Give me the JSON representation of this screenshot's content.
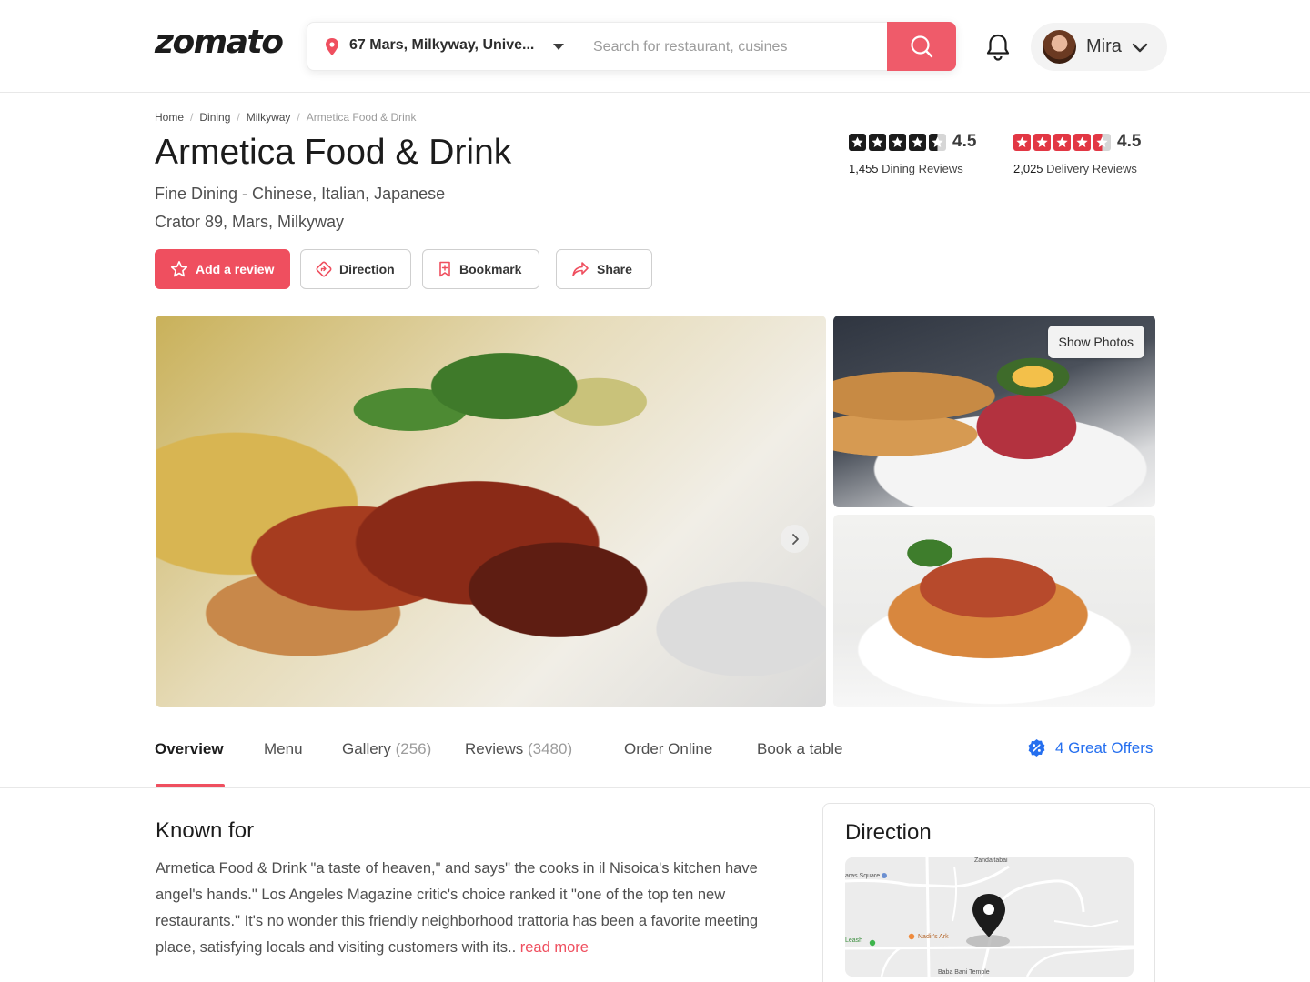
{
  "header": {
    "logo": "zomato",
    "location": "67 Mars, Milkyway, Unive...",
    "search_placeholder": "Search for restaurant, cusines",
    "user_name": "Mira"
  },
  "breadcrumb": [
    "Home",
    "Dining",
    "Milkyway",
    "Armetica Food & Drink"
  ],
  "restaurant": {
    "name": "Armetica Food & Drink",
    "cuisines": "Fine Dining - Chinese, Italian, Japanese",
    "address": "Crator 89, Mars, Milkyway"
  },
  "ratings": {
    "dining": {
      "value": "4.5",
      "count": "1,455",
      "label": "Dining Reviews",
      "stars": 4.5,
      "color": "#1c1c1c"
    },
    "delivery": {
      "value": "4.5",
      "count": "2,025",
      "label": "Delivery Reviews",
      "stars": 4.5,
      "color": "#e23744"
    }
  },
  "actions": {
    "review": "Add a review",
    "direction": "Direction",
    "bookmark": "Bookmark",
    "share": "Share"
  },
  "gallery": {
    "show_photos": "Show Photos"
  },
  "tabs": {
    "overview": "Overview",
    "menu": "Menu",
    "gallery": "Gallery",
    "gallery_count": "(256)",
    "reviews": "Reviews",
    "reviews_count": "(3480)",
    "order_online": "Order Online",
    "book_table": "Book a table",
    "offers": "4 Great Offers"
  },
  "known_for": {
    "title": "Known for",
    "text": "Armetica Food & Drink \"a taste of heaven,\" and says\" the cooks in il Nisoica's kitchen have angel's hands.\" Los Angeles Magazine critic's choice ranked it \"one of the top ten new restaurants.\" It's no wonder this friendly neighborhood trattoria has been a favorite meeting place, satisfying locals and visiting customers with its..",
    "read_more": "read more"
  },
  "direction_card": {
    "title": "Direction",
    "map_labels": {
      "square": "aras Square",
      "leash": "Leash",
      "ark": "Nadir's Ark",
      "temple": "Baba Bani Temple",
      "top": "Zandaltabai"
    }
  },
  "colors": {
    "brand": "#ef4f5f",
    "link": "#256fef"
  }
}
